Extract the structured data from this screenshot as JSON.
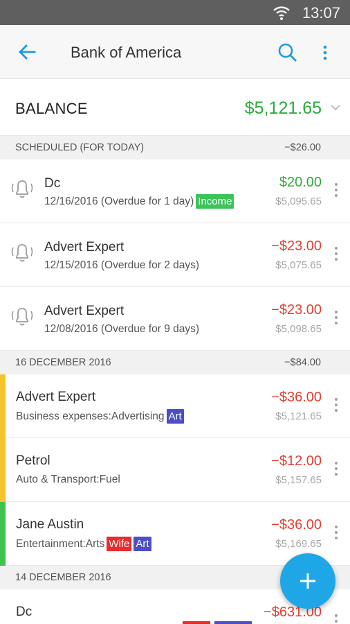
{
  "status_bar": {
    "time": "13:07"
  },
  "app_bar": {
    "title": "Bank of America"
  },
  "balance": {
    "label": "BALANCE",
    "value": "$5,121.65"
  },
  "sections": [
    {
      "label": "SCHEDULED (FOR TODAY)",
      "total": "−$26.00"
    },
    {
      "label": "16 DECEMBER 2016",
      "total": "−$84.00"
    },
    {
      "label": "14 DECEMBER 2016",
      "total": ""
    }
  ],
  "scheduled": [
    {
      "name": "Dc",
      "detail": "12/16/2016 (Overdue for 1 day)",
      "tag": "Income",
      "amount": "$20.00",
      "running": "$5,095.65"
    },
    {
      "name": "Advert Expert",
      "detail": "12/15/2016 (Overdue for 2 days)",
      "amount": "−$23.00",
      "running": "$5,075.65"
    },
    {
      "name": "Advert Expert",
      "detail": "12/08/2016 (Overdue for 9 days)",
      "amount": "−$23.00",
      "running": "$5,098.65"
    }
  ],
  "dec16": [
    {
      "name": "Advert Expert",
      "category": "Business expenses:Advertising",
      "tags": [
        "Art"
      ],
      "amount": "−$36.00",
      "running": "$5,121.65"
    },
    {
      "name": "Petrol",
      "category": "Auto & Transport:Fuel",
      "amount": "−$12.00",
      "running": "$5,157.65"
    },
    {
      "name": "Jane Austin",
      "category": "Entertainment:Arts",
      "tags": [
        "Wife",
        "Art"
      ],
      "amount": "−$36.00",
      "running": "$5,169.65"
    }
  ],
  "dec14": [
    {
      "name": "Dc",
      "amount": "−$631.00"
    }
  ],
  "colors": {
    "income": "#2bab3a",
    "expense": "#e53e2f",
    "accent": "#1fa6e6",
    "stripe_yellow": "#f6c32a",
    "stripe_green": "#3fc34f"
  }
}
